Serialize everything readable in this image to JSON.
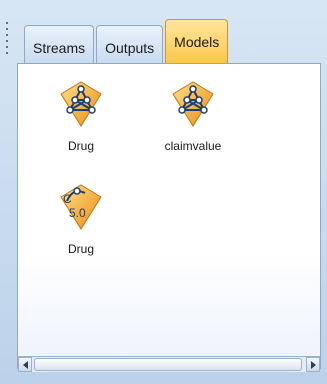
{
  "tabs": [
    {
      "label": "Streams",
      "active": false
    },
    {
      "label": "Outputs",
      "active": false
    },
    {
      "label": "Models",
      "active": true
    }
  ],
  "models": [
    {
      "name": "Drug",
      "icon": "model-network-icon"
    },
    {
      "name": "claimvalue",
      "icon": "model-network-icon"
    },
    {
      "name": "Drug",
      "icon": "model-c50-icon",
      "icon_text": "5.0",
      "icon_prefix": "C"
    }
  ],
  "colors": {
    "active_tab": "#fbc74b",
    "tab": "#c8dbef",
    "panel": "#c9dcef"
  }
}
